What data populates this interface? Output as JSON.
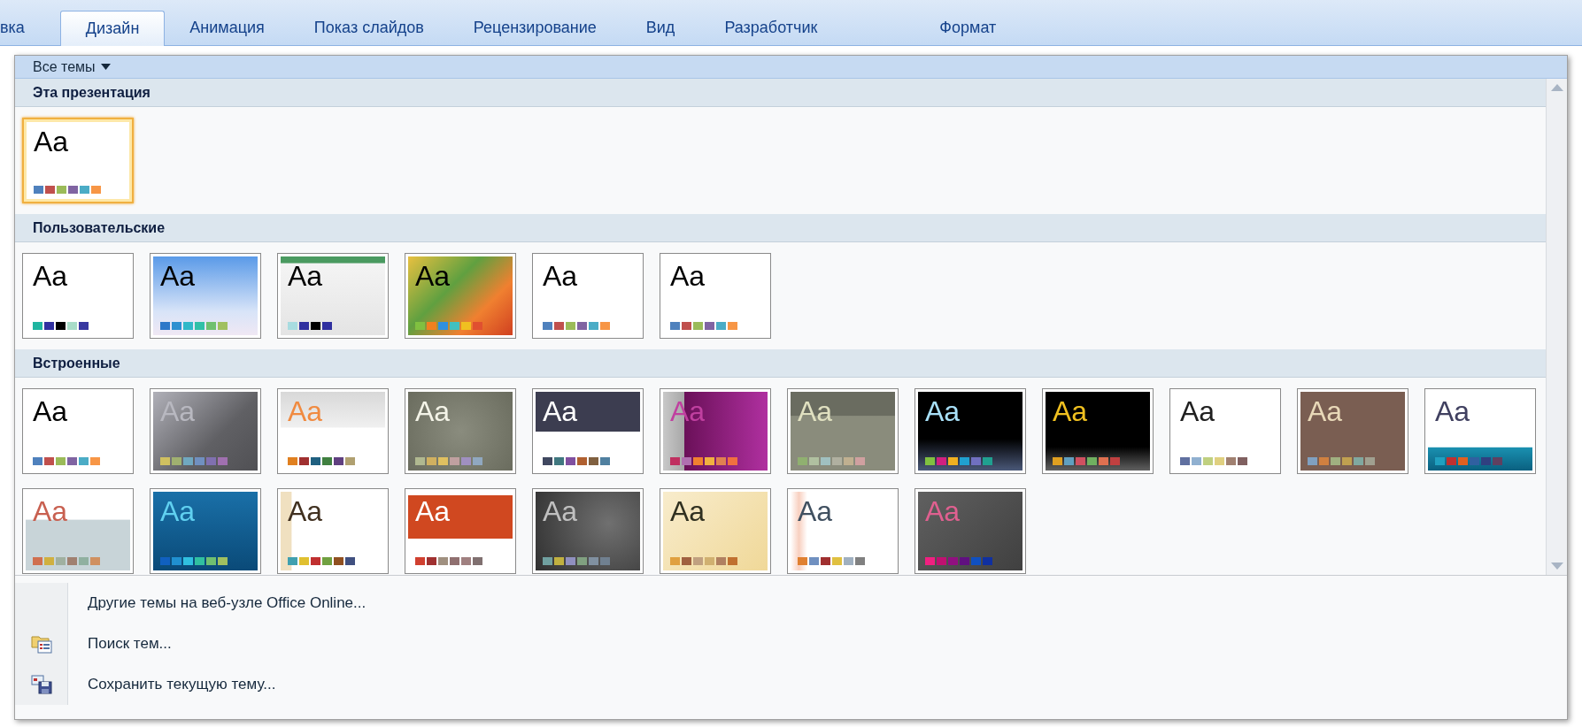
{
  "tabs": [
    {
      "label": "вка",
      "selected": false
    },
    {
      "label": "Дизайн",
      "selected": true
    },
    {
      "label": "Анимация",
      "selected": false
    },
    {
      "label": "Показ слайдов",
      "selected": false
    },
    {
      "label": "Рецензирование",
      "selected": false
    },
    {
      "label": "Вид",
      "selected": false
    },
    {
      "label": "Разработчик",
      "selected": false
    },
    {
      "label": "Формат",
      "selected": false
    }
  ],
  "filter": {
    "label": "Все темы"
  },
  "groups": [
    {
      "title": "Эта презентация",
      "themes": [
        {
          "sample": "Aa",
          "selected": true,
          "color": "#000000",
          "swatches": [
            {
              "color": "#4f81bd"
            },
            {
              "color": "#c0504d"
            },
            {
              "color": "#9bbb59"
            },
            {
              "color": "#8064a2"
            },
            {
              "color": "#4bacc6"
            },
            {
              "color": "#f79646"
            }
          ]
        }
      ]
    },
    {
      "title": "Пользовательские",
      "themes": [
        {
          "sample": "Aa",
          "selected": false,
          "color": "#000000",
          "swatches": [
            {
              "color": "#1fb5a0"
            },
            {
              "color": "#3030a0"
            },
            {
              "color": "#000000"
            },
            {
              "color": "#a8dcc8"
            },
            {
              "color": "#3838a0"
            }
          ]
        },
        {
          "sample": "Aa",
          "selected": false,
          "color": "#000000",
          "swatches": [
            {
              "color": "#2e78c8"
            },
            {
              "color": "#2e90d0"
            },
            {
              "color": "#30b8c8"
            },
            {
              "color": "#30c0a8"
            },
            {
              "color": "#70c070"
            },
            {
              "color": "#a0c060"
            }
          ]
        },
        {
          "sample": "Aa",
          "selected": false,
          "color": "#000000",
          "swatches": [
            {
              "color": "#a8dce0"
            },
            {
              "color": "#3030a0"
            },
            {
              "color": "#000000"
            },
            {
              "color": "#3030a0"
            }
          ]
        },
        {
          "sample": "Aa",
          "selected": false,
          "color": "#000000",
          "swatches": [
            {
              "color": "#80c040"
            },
            {
              "color": "#f08020"
            },
            {
              "color": "#3090e0"
            },
            {
              "color": "#40c0c0"
            },
            {
              "color": "#f0c020"
            },
            {
              "color": "#e05030"
            }
          ]
        },
        {
          "sample": "Aa",
          "selected": false,
          "color": "#000000",
          "swatches": [
            {
              "color": "#4f81bd"
            },
            {
              "color": "#c0504d"
            },
            {
              "color": "#9bbb59"
            },
            {
              "color": "#8064a2"
            },
            {
              "color": "#4bacc6"
            },
            {
              "color": "#f79646"
            }
          ]
        },
        {
          "sample": "Aa",
          "selected": false,
          "color": "#000000",
          "swatches": [
            {
              "color": "#4f81bd"
            },
            {
              "color": "#c0504d"
            },
            {
              "color": "#9bbb59"
            },
            {
              "color": "#8064a2"
            },
            {
              "color": "#4bacc6"
            },
            {
              "color": "#f79646"
            }
          ]
        }
      ]
    },
    {
      "title": "Встроенные",
      "themes": [
        {
          "sample": "Aa",
          "selected": false,
          "color": "#000000",
          "swatches": [
            {
              "color": "#4f81bd"
            },
            {
              "color": "#c0504d"
            },
            {
              "color": "#9bbb59"
            },
            {
              "color": "#8064a2"
            },
            {
              "color": "#4bacc6"
            },
            {
              "color": "#f79646"
            }
          ]
        },
        {
          "sample": "Aa",
          "selected": false,
          "color": "#b8b8c0",
          "swatches": [
            {
              "color": "#d0c060"
            },
            {
              "color": "#a0b070"
            },
            {
              "color": "#70a8c0"
            },
            {
              "color": "#7090c0"
            },
            {
              "color": "#8070b0"
            },
            {
              "color": "#a070b0"
            }
          ]
        },
        {
          "sample": "Aa",
          "selected": false,
          "color": "#f08a40",
          "swatches": [
            {
              "color": "#e08020"
            },
            {
              "color": "#a03030"
            },
            {
              "color": "#206080"
            },
            {
              "color": "#408040"
            },
            {
              "color": "#604080"
            },
            {
              "color": "#b0a070"
            }
          ]
        },
        {
          "sample": "Aa",
          "selected": false,
          "color": "#f4f4e8",
          "swatches": [
            {
              "color": "#b0b890"
            },
            {
              "color": "#d0b060"
            },
            {
              "color": "#e0c060"
            },
            {
              "color": "#c0a0a0"
            },
            {
              "color": "#a090c0"
            },
            {
              "color": "#90a8c0"
            }
          ]
        },
        {
          "sample": "Aa",
          "selected": false,
          "color": "#ffffff",
          "swatches": [
            {
              "color": "#404860"
            },
            {
              "color": "#407880"
            },
            {
              "color": "#8050a0"
            },
            {
              "color": "#b06030"
            },
            {
              "color": "#806040"
            },
            {
              "color": "#5080a0"
            }
          ]
        },
        {
          "sample": "Aa",
          "selected": false,
          "color": "#c040a0",
          "swatches": [
            {
              "color": "#c03060"
            },
            {
              "color": "#b070b0"
            },
            {
              "color": "#f08030"
            },
            {
              "color": "#f0b040"
            },
            {
              "color": "#e08050"
            },
            {
              "color": "#f07040"
            }
          ]
        },
        {
          "sample": "Aa",
          "selected": false,
          "color": "#e0e0c0",
          "swatches": [
            {
              "color": "#90b070"
            },
            {
              "color": "#b0c0a0"
            },
            {
              "color": "#a0c0c0"
            },
            {
              "color": "#b0b0a0"
            },
            {
              "color": "#c0b090"
            },
            {
              "color": "#d0a0a0"
            }
          ]
        },
        {
          "sample": "Aa",
          "selected": false,
          "color": "#a8e0f8",
          "swatches": [
            {
              "color": "#80c040"
            },
            {
              "color": "#d02080"
            },
            {
              "color": "#f0b020"
            },
            {
              "color": "#20a0d0"
            },
            {
              "color": "#7070c0"
            },
            {
              "color": "#20a090"
            }
          ]
        },
        {
          "sample": "Aa",
          "selected": false,
          "color": "#f0c020",
          "swatches": [
            {
              "color": "#e0a020"
            },
            {
              "color": "#60a0c0"
            },
            {
              "color": "#d05060"
            },
            {
              "color": "#70b060"
            },
            {
              "color": "#e07050"
            },
            {
              "color": "#c04040"
            }
          ]
        },
        {
          "sample": "Aa",
          "selected": false,
          "color": "#202020",
          "swatches": [
            {
              "color": "#6070a0"
            },
            {
              "color": "#90b0d0"
            },
            {
              "color": "#c0d080"
            },
            {
              "color": "#e0d080"
            },
            {
              "color": "#a08070"
            },
            {
              "color": "#806060"
            }
          ]
        },
        {
          "sample": "Aa",
          "selected": false,
          "color": "#e8d8b8",
          "swatches": [
            {
              "color": "#80a0c0"
            },
            {
              "color": "#d08040"
            },
            {
              "color": "#a0b080"
            },
            {
              "color": "#c0a050"
            },
            {
              "color": "#80a8a0"
            },
            {
              "color": "#a0a090"
            }
          ]
        },
        {
          "sample": "Aa",
          "selected": false,
          "color": "#404060",
          "swatches": [
            {
              "color": "#20a0c0"
            },
            {
              "color": "#c03030"
            },
            {
              "color": "#e06020"
            },
            {
              "color": "#3060a0"
            },
            {
              "color": "#304080"
            },
            {
              "color": "#604060"
            }
          ]
        },
        {
          "sample": "Aa",
          "selected": false,
          "color": "#c86050",
          "swatches": [
            {
              "color": "#d07050"
            },
            {
              "color": "#d0b040"
            },
            {
              "color": "#a0b0a0"
            },
            {
              "color": "#a08070"
            },
            {
              "color": "#90b0a0"
            },
            {
              "color": "#d09060"
            }
          ]
        },
        {
          "sample": "Aa",
          "selected": false,
          "color": "#60d0f0",
          "swatches": [
            {
              "color": "#1060c0"
            },
            {
              "color": "#2090d0"
            },
            {
              "color": "#30c0e0"
            },
            {
              "color": "#30c0a0"
            },
            {
              "color": "#70c070"
            },
            {
              "color": "#a0c060"
            }
          ]
        },
        {
          "sample": "Aa",
          "selected": false,
          "color": "#403020",
          "swatches": [
            {
              "color": "#40a0b0"
            },
            {
              "color": "#e0c030"
            },
            {
              "color": "#c03030"
            },
            {
              "color": "#70a040"
            },
            {
              "color": "#905020"
            },
            {
              "color": "#405080"
            }
          ]
        },
        {
          "sample": "Aa",
          "selected": false,
          "color": "#ffffff",
          "swatches": [
            {
              "color": "#d04030"
            },
            {
              "color": "#a03030"
            },
            {
              "color": "#a09080"
            },
            {
              "color": "#907070"
            },
            {
              "color": "#a08080"
            },
            {
              "color": "#807070"
            }
          ]
        },
        {
          "sample": "Aa",
          "selected": false,
          "color": "#c0c0c0",
          "swatches": [
            {
              "color": "#70a0a0"
            },
            {
              "color": "#c0b040"
            },
            {
              "color": "#9090c0"
            },
            {
              "color": "#80a080"
            },
            {
              "color": "#8090a0"
            },
            {
              "color": "#708090"
            }
          ]
        },
        {
          "sample": "Aa",
          "selected": false,
          "color": "#303020",
          "swatches": [
            {
              "color": "#e0a040"
            },
            {
              "color": "#a06040"
            },
            {
              "color": "#c0a080"
            },
            {
              "color": "#d0b070"
            },
            {
              "color": "#b08060"
            },
            {
              "color": "#c07030"
            }
          ]
        },
        {
          "sample": "Aa",
          "selected": false,
          "color": "#405060",
          "swatches": [
            {
              "color": "#e08030"
            },
            {
              "color": "#7090c0"
            },
            {
              "color": "#a03030"
            },
            {
              "color": "#e0c040"
            },
            {
              "color": "#a0b0c0"
            },
            {
              "color": "#808080"
            }
          ]
        },
        {
          "sample": "Aa",
          "selected": false,
          "color": "#e06090",
          "swatches": [
            {
              "color": "#f02080"
            },
            {
              "color": "#c01070"
            },
            {
              "color": "#901080"
            },
            {
              "color": "#601080"
            },
            {
              "color": "#1050c0"
            },
            {
              "color": "#1030a0"
            }
          ]
        }
      ]
    }
  ],
  "menu": [
    {
      "label": "Другие темы на веб-узле Office Online...",
      "kind": "plain"
    },
    {
      "label": "Поиск тем...",
      "kind": "browse"
    },
    {
      "label": "Сохранить текущую тему...",
      "kind": "save"
    }
  ]
}
